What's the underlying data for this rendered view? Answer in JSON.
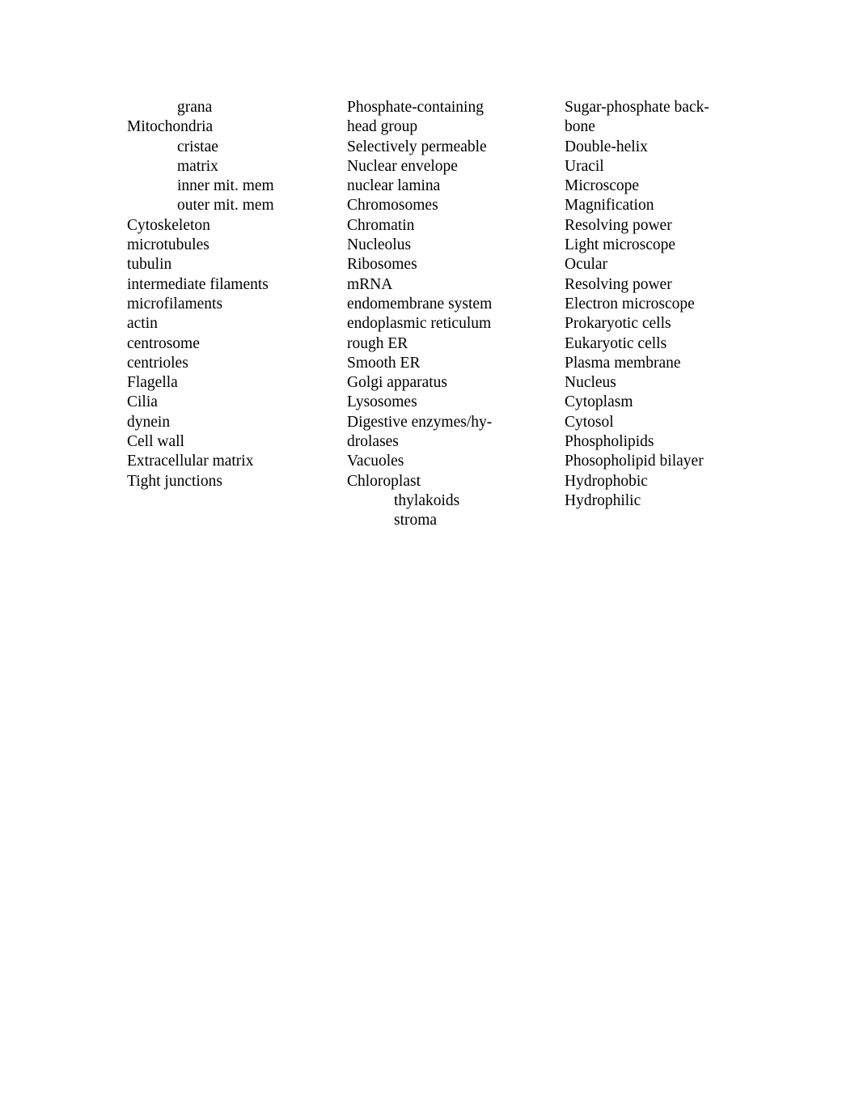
{
  "document": {
    "page_background": "#ffffff",
    "text_color": "#000000",
    "columns": [
      {
        "id": "column-1",
        "terms": [
          {
            "label": "grana",
            "indent": 1
          },
          {
            "label": "Mitochondria",
            "indent": 0
          },
          {
            "label": "cristae",
            "indent": 1
          },
          {
            "label": "matrix",
            "indent": 1
          },
          {
            "label": "inner mit. mem",
            "indent": 1
          },
          {
            "label": "outer mit. mem",
            "indent": 1
          },
          {
            "label": "Cytoskeleton",
            "indent": 0
          },
          {
            "label": "microtubules",
            "indent": 0
          },
          {
            "label": "tubulin",
            "indent": 0
          },
          {
            "label": "intermediate filaments",
            "indent": 0
          },
          {
            "label": "microfilaments",
            "indent": 0
          },
          {
            "label": "actin",
            "indent": 0
          },
          {
            "label": "centrosome",
            "indent": 0
          },
          {
            "label": "centrioles",
            "indent": 0
          },
          {
            "label": "Flagella",
            "indent": 0
          },
          {
            "label": "Cilia",
            "indent": 0
          },
          {
            "label": "dynein",
            "indent": 0
          },
          {
            "label": "Cell wall",
            "indent": 0
          },
          {
            "label": "Extracellular matrix",
            "indent": 0
          },
          {
            "label": "Tight junctions",
            "indent": 0
          }
        ]
      },
      {
        "id": "column-2",
        "terms": [
          {
            "label": "Phosphate-containing head group",
            "indent": 0,
            "lines": [
              "Phosphate-containing",
              "head group"
            ]
          },
          {
            "label": "Selectively permeable",
            "indent": 0
          },
          {
            "label": "Nuclear envelope",
            "indent": 0
          },
          {
            "label": "nuclear lamina",
            "indent": 0
          },
          {
            "label": "Chromosomes",
            "indent": 0
          },
          {
            "label": "Chromatin",
            "indent": 0
          },
          {
            "label": "Nucleolus",
            "indent": 0
          },
          {
            "label": "Ribosomes",
            "indent": 0
          },
          {
            "label": "mRNA",
            "indent": 0
          },
          {
            "label": "endomembrane system",
            "indent": 0
          },
          {
            "label": "endoplasmic reticulum",
            "indent": 0
          },
          {
            "label": "rough ER",
            "indent": 0
          },
          {
            "label": "Smooth ER",
            "indent": 0
          },
          {
            "label": "Golgi apparatus",
            "indent": 0
          },
          {
            "label": "Lysosomes",
            "indent": 0
          },
          {
            "label": "Digestive enzymes/hydrolases",
            "indent": 0,
            "lines": [
              "Digestive enzymes/hy-",
              "drolases"
            ]
          },
          {
            "label": "Vacuoles",
            "indent": 0
          },
          {
            "label": "Chloroplast",
            "indent": 0
          },
          {
            "label": "thylakoids",
            "indent": 2
          },
          {
            "label": "stroma",
            "indent": 2
          }
        ]
      },
      {
        "id": "column-3",
        "terms": [
          {
            "label": "Sugar-phosphate backbone",
            "indent": 0,
            "lines": [
              "Sugar-phosphate back-",
              "bone"
            ]
          },
          {
            "label": "Double-helix",
            "indent": 0
          },
          {
            "label": "Uracil",
            "indent": 0
          },
          {
            "label": "Microscope",
            "indent": 0
          },
          {
            "label": "Magnification",
            "indent": 0
          },
          {
            "label": "Resolving power",
            "indent": 0
          },
          {
            "label": "Light microscope",
            "indent": 0
          },
          {
            "label": "Ocular",
            "indent": 0
          },
          {
            "label": "Resolving power",
            "indent": 0
          },
          {
            "label": "Electron microscope",
            "indent": 0
          },
          {
            "label": "Prokaryotic cells",
            "indent": 0
          },
          {
            "label": "Eukaryotic cells",
            "indent": 0
          },
          {
            "label": "Plasma membrane",
            "indent": 0
          },
          {
            "label": "Nucleus",
            "indent": 0
          },
          {
            "label": "Cytoplasm",
            "indent": 0
          },
          {
            "label": "Cytosol",
            "indent": 0
          },
          {
            "label": "Phospholipids",
            "indent": 0
          },
          {
            "label": "Phosopholipid bilayer",
            "indent": 0
          },
          {
            "label": "Hydrophobic",
            "indent": 0
          },
          {
            "label": "Hydrophilic",
            "indent": 0
          }
        ]
      }
    ]
  }
}
